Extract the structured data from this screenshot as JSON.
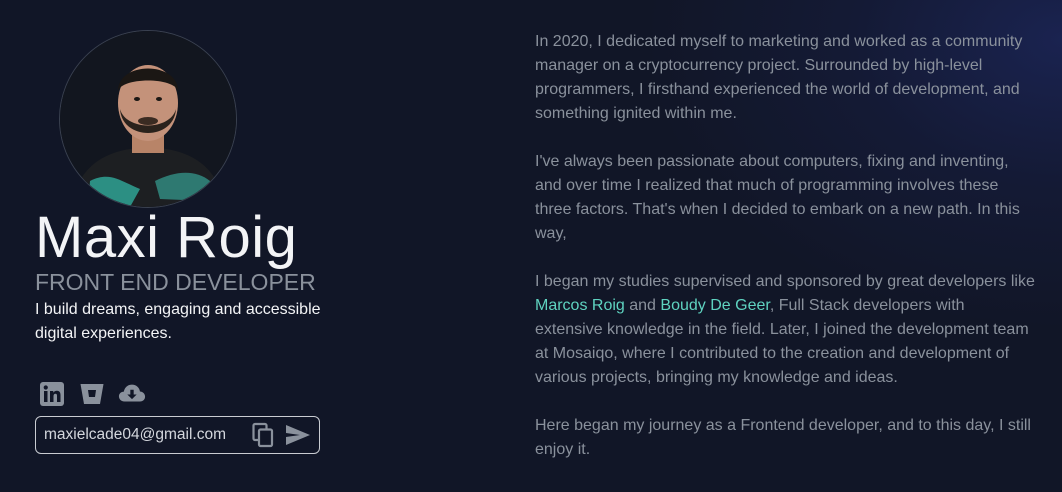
{
  "profile": {
    "name": "Maxi Roig",
    "role": "FRONT END DEVELOPER",
    "tagline": "I build dreams, engaging and accessible digital experiences.",
    "email": "maxielcade04@gmail.com"
  },
  "socials": [
    {
      "icon": "linkedin-icon"
    },
    {
      "icon": "bitbucket-icon"
    },
    {
      "icon": "cloud-download-icon"
    }
  ],
  "about": {
    "p1": "In 2020, I dedicated myself to marketing and worked as a community manager on a cryptocurrency project. Surrounded by high-level programmers, I firsthand experienced the world of development, and something ignited within me.",
    "p2": "I've always been passionate about computers, fixing and inventing, and over time I realized that much of programming involves these three factors. That's when I decided to embark on a new path. In this way,",
    "p3_start": "I began my studies supervised and sponsored by great developers like ",
    "link1": "Marcos Roig",
    "p3_and": " and ",
    "link2": "Boudy De Geer",
    "p3_end": ", Full Stack developers with extensive knowledge in the field. Later, I joined the development team at Mosaiqo, where I contributed to the creation and development of various projects, bringing my knowledge and ideas.",
    "p4": "Here began my journey as a Frontend developer, and to this day, I still enjoy it."
  },
  "colors": {
    "background": "#111627",
    "accent": "#5fd3c0",
    "muted_text": "#8a919c",
    "primary_text": "#f3f4f6"
  }
}
